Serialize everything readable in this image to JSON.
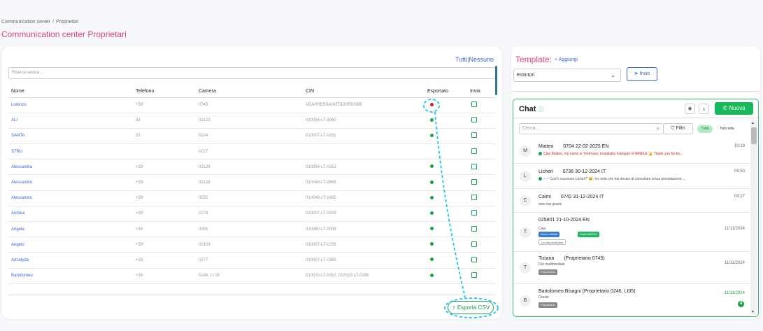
{
  "breadcrumb": [
    "Communication center",
    "/",
    "Proprietari"
  ],
  "page_title": "Communication center Proprietari",
  "table": {
    "select_all": "Tutti",
    "separator": "|",
    "select_none": "Nessuno",
    "search_placeholder": "Ricerca veloce...",
    "columns": [
      "Nome",
      "Telefono",
      "Camera",
      "CIN",
      "Esportato",
      "Invia"
    ],
    "rows": [
      {
        "name": "Lorenzo",
        "phone": "+39",
        "room": "0743",
        "cin": "VDAPRESSAINTDIDIRR0066",
        "exported": "red"
      },
      {
        "name": "ALI",
        "phone": "33",
        "room": "02123",
        "cin": "010054-LT-3060",
        "exported": "green"
      },
      {
        "name": "SANTA",
        "phone": "33",
        "room": "0224",
        "cin": "010007-LT-0281",
        "exported": "green"
      },
      {
        "name": "STRU",
        "phone": "",
        "room": "0227",
        "cin": "",
        "exported": ""
      },
      {
        "name": "Alessandra",
        "phone": "+39",
        "room": "02125",
        "cin": "010054-LT-0353",
        "exported": "green"
      },
      {
        "name": "Alessandro",
        "phone": "+39",
        "room": "02128",
        "cin": "010048-LT-2669",
        "exported": "green"
      },
      {
        "name": "Alessandro",
        "phone": "+39",
        "room": "0255",
        "cin": "010048-LT-1465",
        "exported": "green"
      },
      {
        "name": "Andrea",
        "phone": "+39",
        "room": "0278",
        "cin": "010007-LT-0509",
        "exported": "green"
      },
      {
        "name": "Angela",
        "phone": "+39",
        "room": "0265",
        "cin": "010060-LT-0008",
        "exported": "green"
      },
      {
        "name": "Angelo",
        "phone": "+39",
        "room": "02103",
        "cin": "010007-LT-0236",
        "exported": "green"
      },
      {
        "name": "Annalyda",
        "phone": "+39",
        "room": "0277",
        "cin": "010007-LT-0395",
        "exported": "green"
      },
      {
        "name": "Bartolomeo",
        "phone": "+39",
        "room": "0246, LI 05",
        "cin": "010015-LT-0052, 010015-LT-0298",
        "exported": "green"
      }
    ],
    "export_button": "Esporta CSV"
  },
  "template": {
    "title": "Template:",
    "add_label": "+ Aggiungi",
    "selected": "Estintori",
    "send_label": "Invio"
  },
  "chat": {
    "title": "Chat",
    "new_label": "Nuova",
    "search_placeholder": "Cerca...",
    "filter_label": "Filtri",
    "tab_all": "Tutte",
    "tab_unread": "Non lette",
    "items": [
      {
        "initial": "M",
        "name": "Matteo",
        "meta": "0704 22-02-2025 EN",
        "preview": "Ciao Matteo, my name is Tommaso, hospitality manager of ARIELE 🔔 Thank you for bo...",
        "time": "10:19",
        "unread": ""
      },
      {
        "initial": "L",
        "name": "Licheri",
        "meta": "0736 30-12-2024 IT",
        "preview": "Cos'è successo Licheri? 😢, ho visto che hai deciso di cancellare la tua prenotazione ...",
        "time": "09:50",
        "unread": ""
      },
      {
        "initial": "C",
        "name": "Caimi",
        "meta": "0742 31-12-2024 IT",
        "preview": "wow top grazie",
        "time": "00:27",
        "unread": ""
      },
      {
        "initial": "T",
        "name": "",
        "meta": "025801 21-10-2024 EN",
        "preview": "Ciao",
        "time": "11/11/2024",
        "tags": [
          "Nuovo cliente",
          "Ospiti ARIELE"
        ],
        "subtag": "La mia prima lista",
        "unread": ""
      },
      {
        "initial": "T",
        "name": "Tiziana",
        "meta": "(Proprietario 0745)",
        "preview": "File multimediale",
        "time": "11/11/2024",
        "tags": [
          "Proprietario"
        ],
        "unread": ""
      },
      {
        "initial": "B",
        "name": "Bartolomeo Bisagni (Proprietario 0246, LI05)",
        "meta": "",
        "preview": "Grazie",
        "time": "11/11/2024",
        "tags": [
          "Proprietario"
        ],
        "unread": "4"
      }
    ]
  }
}
